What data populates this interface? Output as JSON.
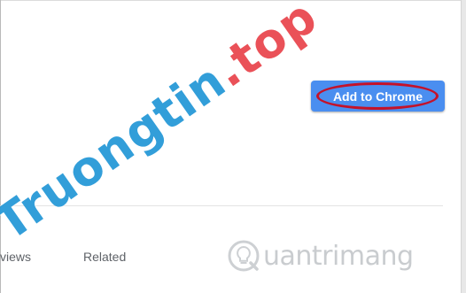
{
  "watermark": {
    "brand": "Truongtin",
    "dot": ".",
    "tld": "top"
  },
  "actions": {
    "add_to_chrome_label": "Add to Chrome"
  },
  "tabs": [
    {
      "label": "views"
    },
    {
      "label": "Related"
    }
  ],
  "logo": {
    "text": "uantrimang"
  },
  "colors": {
    "button": "#4a8ef0",
    "highlight": "#c4122a",
    "watermark_blue": "#2196d6",
    "watermark_red": "#e83e46"
  }
}
